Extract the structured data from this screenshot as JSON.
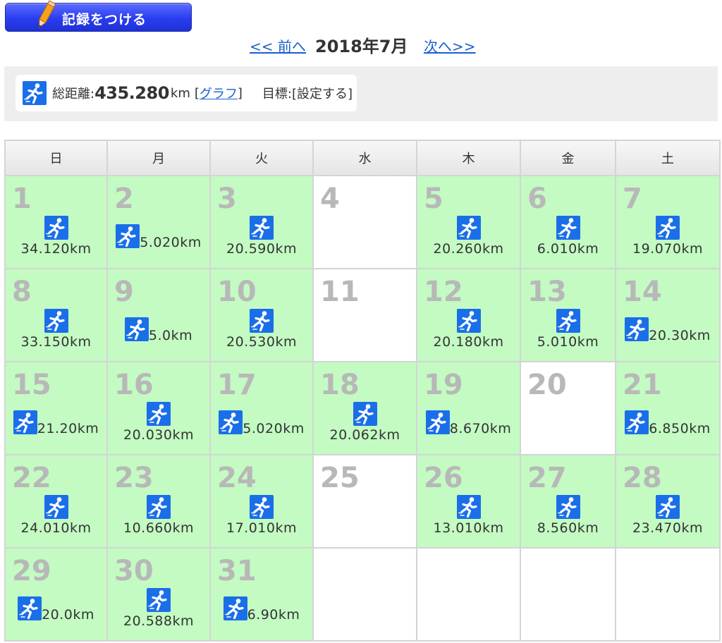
{
  "record_button": {
    "label": "記録をつける"
  },
  "nav": {
    "prev": "<< 前へ",
    "current": "2018年7月",
    "next": "次へ>>"
  },
  "summary": {
    "total_label": "総距離:",
    "total_value": "435.280",
    "total_unit": "km",
    "graph_open": "[",
    "graph_link": "グラフ",
    "graph_close": "]",
    "goal_label": "目標:",
    "goal_link": "[設定する]"
  },
  "weekdays": [
    "日",
    "月",
    "火",
    "水",
    "木",
    "金",
    "土"
  ],
  "weeks": [
    [
      {
        "day": "1",
        "km": "34.120km",
        "layout": "stack"
      },
      {
        "day": "2",
        "km": "5.020km",
        "layout": "inline"
      },
      {
        "day": "3",
        "km": "20.590km",
        "layout": "stack"
      },
      {
        "day": "4",
        "km": null,
        "layout": "empty"
      },
      {
        "day": "5",
        "km": "20.260km",
        "layout": "stack"
      },
      {
        "day": "6",
        "km": "6.010km",
        "layout": "stack"
      },
      {
        "day": "7",
        "km": "19.070km",
        "layout": "stack"
      }
    ],
    [
      {
        "day": "8",
        "km": "33.150km",
        "layout": "stack"
      },
      {
        "day": "9",
        "km": "5.0km",
        "layout": "inline"
      },
      {
        "day": "10",
        "km": "20.530km",
        "layout": "stack"
      },
      {
        "day": "11",
        "km": null,
        "layout": "empty"
      },
      {
        "day": "12",
        "km": "20.180km",
        "layout": "stack"
      },
      {
        "day": "13",
        "km": "5.010km",
        "layout": "stack"
      },
      {
        "day": "14",
        "km": "20.30km",
        "layout": "inline"
      }
    ],
    [
      {
        "day": "15",
        "km": "21.20km",
        "layout": "inline"
      },
      {
        "day": "16",
        "km": "20.030km",
        "layout": "stack"
      },
      {
        "day": "17",
        "km": "5.020km",
        "layout": "inline"
      },
      {
        "day": "18",
        "km": "20.062km",
        "layout": "stack"
      },
      {
        "day": "19",
        "km": "8.670km",
        "layout": "inline"
      },
      {
        "day": "20",
        "km": null,
        "layout": "empty"
      },
      {
        "day": "21",
        "km": "6.850km",
        "layout": "inline"
      }
    ],
    [
      {
        "day": "22",
        "km": "24.010km",
        "layout": "stack"
      },
      {
        "day": "23",
        "km": "10.660km",
        "layout": "stack"
      },
      {
        "day": "24",
        "km": "17.010km",
        "layout": "stack"
      },
      {
        "day": "25",
        "km": null,
        "layout": "empty"
      },
      {
        "day": "26",
        "km": "13.010km",
        "layout": "stack"
      },
      {
        "day": "27",
        "km": "8.560km",
        "layout": "stack"
      },
      {
        "day": "28",
        "km": "23.470km",
        "layout": "stack"
      }
    ],
    [
      {
        "day": "29",
        "km": "20.0km",
        "layout": "inline"
      },
      {
        "day": "30",
        "km": "20.588km",
        "layout": "stack"
      },
      {
        "day": "31",
        "km": "6.90km",
        "layout": "inline"
      },
      {
        "day": "",
        "km": null,
        "layout": "blank"
      },
      {
        "day": "",
        "km": null,
        "layout": "blank"
      },
      {
        "day": "",
        "km": null,
        "layout": "blank"
      },
      {
        "day": "",
        "km": null,
        "layout": "blank"
      }
    ]
  ],
  "icons": {
    "run": "running-person-icon",
    "pencil": "pencil-icon"
  },
  "colors": {
    "run_cell": "#c3fbc3",
    "icon_bg": "#1a6fe8",
    "link": "#1a5fd0",
    "button": "#2a3df0"
  }
}
